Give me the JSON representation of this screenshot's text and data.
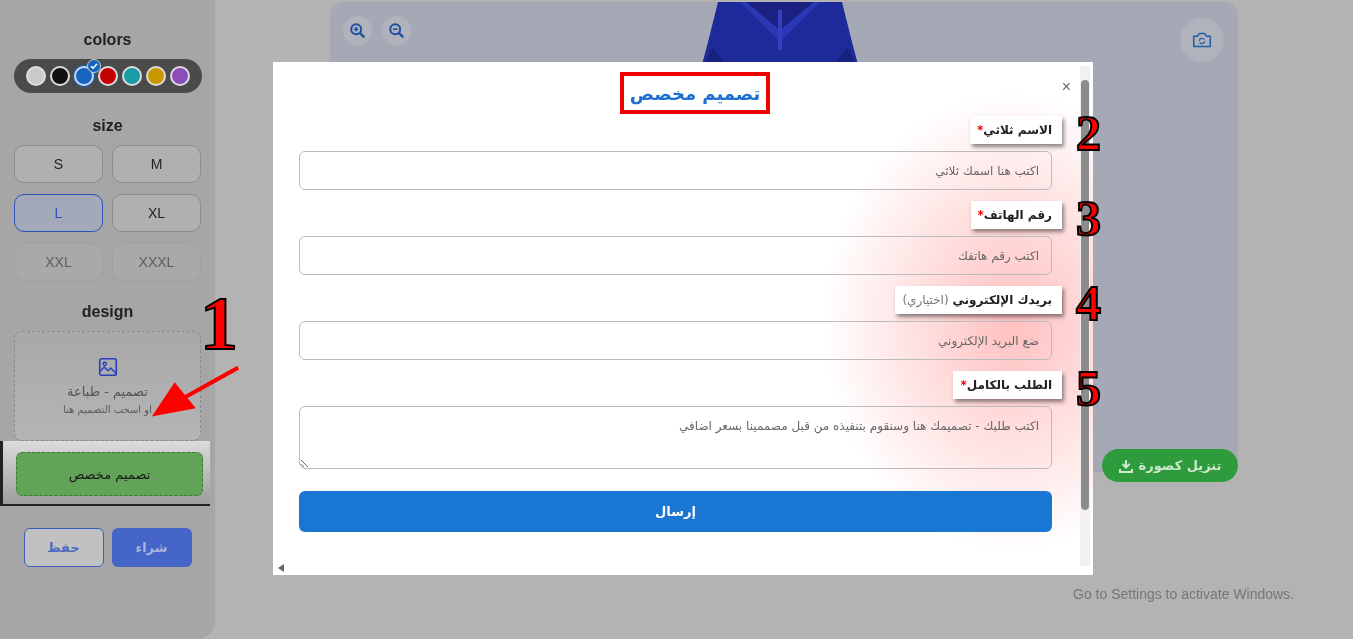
{
  "sidebar": {
    "colors_title": "colors",
    "colors": [
      {
        "color": "#cacaca",
        "selected": false
      },
      {
        "color": "#111111",
        "selected": false
      },
      {
        "color": "#1565c0",
        "selected": true
      },
      {
        "color": "#c40000",
        "selected": false
      },
      {
        "color": "#1a9ba8",
        "selected": false
      },
      {
        "color": "#c99700",
        "selected": false
      },
      {
        "color": "#8c4db8",
        "selected": false
      }
    ],
    "size_title": "size",
    "size_rows": [
      {
        "sizes": [
          {
            "label": "M",
            "selected": false,
            "disabled": false
          },
          {
            "label": "S",
            "selected": false,
            "disabled": false
          }
        ]
      },
      {
        "sizes": [
          {
            "label": "XL",
            "selected": false,
            "disabled": false
          },
          {
            "label": "L",
            "selected": true,
            "disabled": false
          }
        ]
      },
      {
        "sizes": [
          {
            "label": "XXXL",
            "selected": false,
            "disabled": true
          },
          {
            "label": "XXL",
            "selected": false,
            "disabled": true
          }
        ]
      }
    ],
    "design_title": "design",
    "upload": {
      "title": "تصميم - طباعة",
      "hint": "او اسحب التصميم هنا"
    },
    "custom_button": "تصميم مخصص",
    "save_button": "حفظ",
    "buy_button": "شراء"
  },
  "preview": {
    "download_button": "تنزيل كصورة"
  },
  "modal": {
    "title": "تصميم مخصص",
    "close": "×",
    "fields": [
      {
        "kind": "input",
        "label": "الاسم ثلاثي",
        "required_mark": "*",
        "placeholder": "اكتب هنا اسمك ثلاثي"
      },
      {
        "kind": "input",
        "label": "رقم الهاتف",
        "required_mark": "*",
        "placeholder": "اكتب رقم هاتفك"
      },
      {
        "kind": "input",
        "label": "بريدك الإلكتروني",
        "optional_note": "(اختياري)",
        "placeholder": "ضع البريد الإلكتروني"
      },
      {
        "kind": "textarea",
        "label": "الطلب بالكامل",
        "required_mark": "*",
        "placeholder": "اكتب طلبك - تصميمك هنا وسنقوم بتنفيذه من قبل مصممينا بسعر اضافي"
      }
    ],
    "submit": "إرسال"
  },
  "pointer_annotation": {
    "label": "1"
  },
  "annotations": [
    {
      "label": "2"
    },
    {
      "label": "3"
    },
    {
      "label": "4"
    },
    {
      "label": "5"
    }
  ],
  "system_notice": "Go to Settings to activate Windows."
}
